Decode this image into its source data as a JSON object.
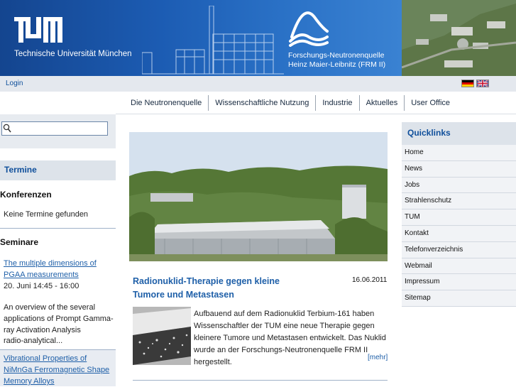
{
  "header": {
    "university_name": "Technische Universität München",
    "facility_name_line1": "Forschungs-Neutronenquelle",
    "facility_name_line2": "Heinz Maier-Leibnitz (FRM II)"
  },
  "utility": {
    "login_label": "Login",
    "languages": [
      "german-flag-icon",
      "english-flag-icon"
    ]
  },
  "topnav": {
    "items": [
      {
        "label": "Die Neutronenquelle"
      },
      {
        "label": "Wissenschaftliche Nutzung"
      },
      {
        "label": "Industrie"
      },
      {
        "label": "Aktuelles"
      },
      {
        "label": "User Office"
      }
    ]
  },
  "search": {
    "value": "",
    "icon": "magnifier-icon"
  },
  "left": {
    "termine_heading": "Termine",
    "konferenzen_heading": "Konferenzen",
    "no_events": "Keine Termine gefunden",
    "seminare_heading": "Seminare",
    "events": [
      {
        "title": "The multiple dimensions of PGAA measurements",
        "time": "20. Juni 14:45 - 16:00"
      },
      {
        "title": "An overview of the several applications of Prompt Gamma-ray Activation Analysis",
        "time": "radio-analytical..."
      },
      {
        "title": "Vibrational Properties of NiMnGa Ferromagnetic Shape Memory Alloys",
        "time": ""
      }
    ]
  },
  "news": {
    "title": "Radionuklid-Therapie gegen kleine Tumore und Metastasen",
    "date": "16.06.2011",
    "body": "Aufbauend auf dem Radionuklid Terbium-161 haben Wissenschaftler der TUM eine neue Therapie gegen kleinere Tumore und Metastasen entwickelt. Das Nuklid wurde an der Forschungs-Neutronenquelle FRM II hergestellt.",
    "more_label": "[mehr]"
  },
  "quicklinks": {
    "heading": "Quicklinks",
    "items": [
      "Home",
      "News",
      "Jobs",
      "Strahlenschutz",
      "TUM",
      "Kontakt",
      "Telefonverzeichnis",
      "Webmail",
      "Impressum",
      "Sitemap"
    ]
  },
  "colors": {
    "banner_blue": "#1b5cb0",
    "link_blue": "#1e5fa8",
    "heading_blue": "#0f4f9b",
    "panel_gray": "#dde3ea"
  }
}
